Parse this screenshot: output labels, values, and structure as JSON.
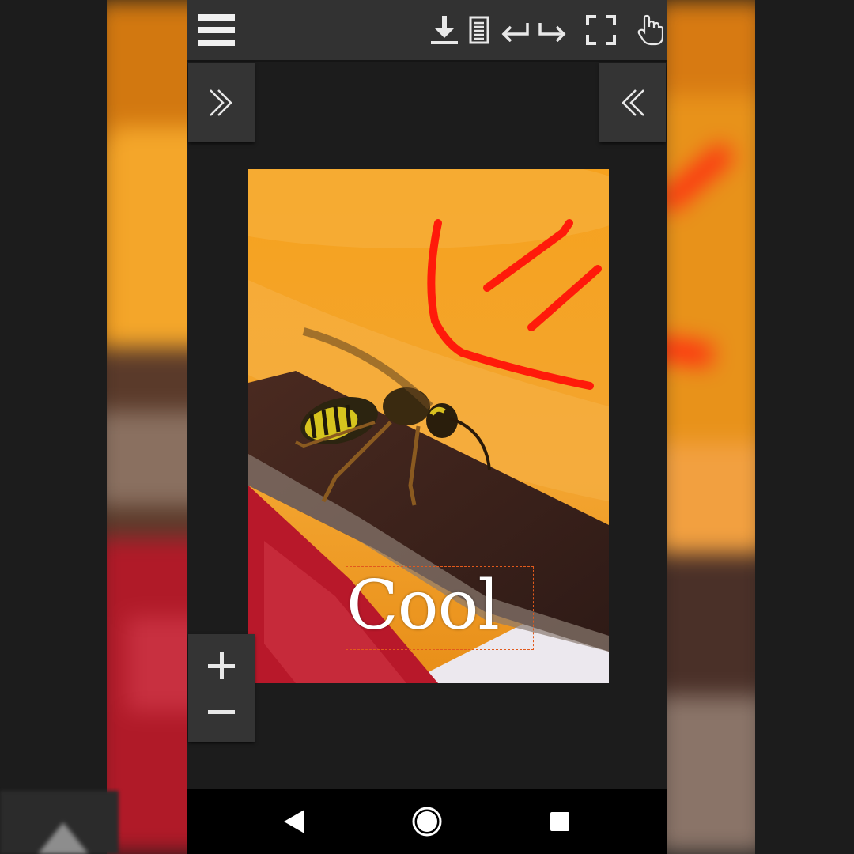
{
  "overlay_text": {
    "value": "Cool",
    "color": "#ffffff",
    "box_border_color": "#e25a1c"
  },
  "toolbar": {
    "icons": [
      "menu-icon",
      "download-icon",
      "document-icon",
      "undo-icon",
      "redo-icon",
      "fullscreen-icon",
      "hand-pointer-icon"
    ]
  },
  "side_panels": {
    "left_icon": "double-chevron-right-icon",
    "right_icon": "double-chevron-left-icon"
  },
  "zoom": {
    "icons": [
      "plus-icon",
      "minus-icon"
    ]
  },
  "navigation_bar": {
    "icons": [
      "back-icon",
      "home-icon",
      "recents-icon"
    ]
  },
  "colors": {
    "toolbar_bg": "#323232",
    "app_bg": "#1c1c1c",
    "drawing_stroke": "#ff1a0a",
    "navbar_bg": "#000000"
  }
}
